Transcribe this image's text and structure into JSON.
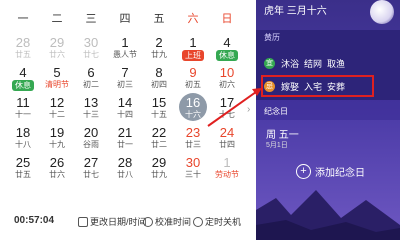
{
  "weekdays": [
    "一",
    "二",
    "三",
    "四",
    "五",
    "六",
    "日"
  ],
  "weeks": [
    [
      {
        "d": "28",
        "l": "廿五",
        "dim": true
      },
      {
        "d": "29",
        "l": "廿六",
        "dim": true
      },
      {
        "d": "30",
        "l": "廿七",
        "dim": true
      },
      {
        "d": "1",
        "l": "愚人节"
      },
      {
        "d": "2",
        "l": "廿九"
      },
      {
        "d": "1",
        "l": "上班",
        "tag": "上班",
        "tagc": "red"
      },
      {
        "d": "4",
        "l": "休息",
        "tag": "休息",
        "tagc": "green"
      }
    ],
    [
      {
        "d": "4",
        "l": "休息",
        "tag": "休息",
        "tagc": "green"
      },
      {
        "d": "5",
        "l": "清明节",
        "lred": true
      },
      {
        "d": "6",
        "l": "初二"
      },
      {
        "d": "7",
        "l": "初三"
      },
      {
        "d": "8",
        "l": "初四"
      },
      {
        "d": "9",
        "l": "初五",
        "red": true
      },
      {
        "d": "10",
        "l": "初六",
        "red": true
      }
    ],
    [
      {
        "d": "11",
        "l": "十一"
      },
      {
        "d": "12",
        "l": "十二"
      },
      {
        "d": "13",
        "l": "十三"
      },
      {
        "d": "14",
        "l": "十四"
      },
      {
        "d": "15",
        "l": "十五"
      },
      {
        "d": "16",
        "l": "十六",
        "sel": true
      },
      {
        "d": "17",
        "l": "十七"
      }
    ],
    [
      {
        "d": "18",
        "l": "十八"
      },
      {
        "d": "19",
        "l": "十九"
      },
      {
        "d": "20",
        "l": "谷雨"
      },
      {
        "d": "21",
        "l": "廿一"
      },
      {
        "d": "22",
        "l": "廿二"
      },
      {
        "d": "23",
        "l": "廿三",
        "red": true
      },
      {
        "d": "24",
        "l": "廿四",
        "red": true
      }
    ],
    [
      {
        "d": "25",
        "l": "廿五"
      },
      {
        "d": "26",
        "l": "廿六"
      },
      {
        "d": "27",
        "l": "廿七"
      },
      {
        "d": "28",
        "l": "廿八"
      },
      {
        "d": "29",
        "l": "廿九"
      },
      {
        "d": "30",
        "l": "三十",
        "red": true
      },
      {
        "d": "1",
        "l": "劳动节",
        "lred": true,
        "dim": true
      }
    ]
  ],
  "footer": {
    "time": "00:57:04",
    "change_label": "更改日期/时间",
    "calib_label": "校准时间",
    "shutdown_label": "定时关机"
  },
  "panel": {
    "title": "虎年 三月十六",
    "section_almanac": "黄历",
    "yi_badge": "宜",
    "yi_items": "沐浴  结网  取渔",
    "ji_badge": "忌",
    "ji_items": "嫁娶  入宅  安葬",
    "section_anniv": "纪念日",
    "next_day": "周 五一",
    "next_date": "5月1日",
    "add_label": "添加纪念日"
  },
  "colors": {
    "accent_red": "#e8462c",
    "green": "#35a852",
    "panel_bg": "#3b2f8a"
  }
}
